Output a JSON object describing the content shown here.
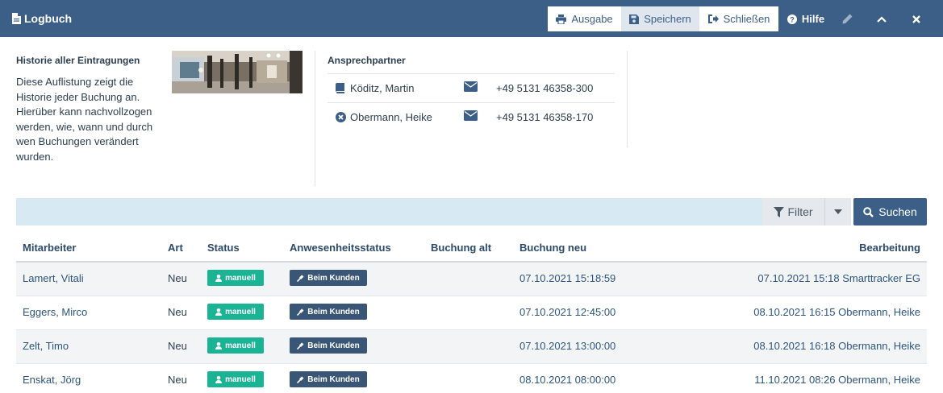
{
  "header": {
    "title": "Logbuch",
    "buttons": {
      "ausgabe": "Ausgabe",
      "speichern": "Speichern",
      "schliessen": "Schließen",
      "hilfe": "Hilfe"
    },
    "colors": {
      "bar": "#3c5f87"
    }
  },
  "info": {
    "title": "Historie aller Eintragungen",
    "text": "Diese Auflistung zeigt die Historie jeder Buchung an. Hierüber kann nachvollzogen werden, wie, wann und durch wen Buchungen verändert wurden."
  },
  "contacts": {
    "title": "Ansprechpartner",
    "items": [
      {
        "name": "Köditz, Martin",
        "phone": "+49 5131 46358-300",
        "icon": "book-icon"
      },
      {
        "name": "Obermann, Heike",
        "phone": "+49 5131 46358-170",
        "icon": "cancel-circle-icon"
      }
    ]
  },
  "search": {
    "filter_label": "Filter",
    "search_label": "Suchen"
  },
  "table": {
    "headers": {
      "mitarbeiter": "Mitarbeiter",
      "art": "Art",
      "status": "Status",
      "anwesenheit": "Anwesenheitsstatus",
      "buchung_alt": "Buchung alt",
      "buchung_neu": "Buchung neu",
      "bearbeitung": "Bearbeitung"
    },
    "rows": [
      {
        "mitarbeiter": "Lamert, Vitali",
        "art": "Neu",
        "status": "manuell",
        "anwesenheit": "Beim Kunden",
        "buchung_alt": "",
        "buchung_neu": "07.10.2021 15:18:59",
        "bearbeitung": "07.10.2021 15:18 Smarttracker EG"
      },
      {
        "mitarbeiter": "Eggers, Mirco",
        "art": "Neu",
        "status": "manuell",
        "anwesenheit": "Beim Kunden",
        "buchung_alt": "",
        "buchung_neu": "07.10.2021 12:45:00",
        "bearbeitung": "08.10.2021 16:15 Obermann, Heike"
      },
      {
        "mitarbeiter": "Zelt, Timo",
        "art": "Neu",
        "status": "manuell",
        "anwesenheit": "Beim Kunden",
        "buchung_alt": "",
        "buchung_neu": "07.10.2021 13:00:00",
        "bearbeitung": "08.10.2021 16:18 Obermann, Heike"
      },
      {
        "mitarbeiter": "Enskat, Jörg",
        "art": "Neu",
        "status": "manuell",
        "anwesenheit": "Beim Kunden",
        "buchung_alt": "",
        "buchung_neu": "08.10.2021 08:00:00",
        "bearbeitung": "11.10.2021 08:26 Obermann, Heike"
      }
    ]
  }
}
